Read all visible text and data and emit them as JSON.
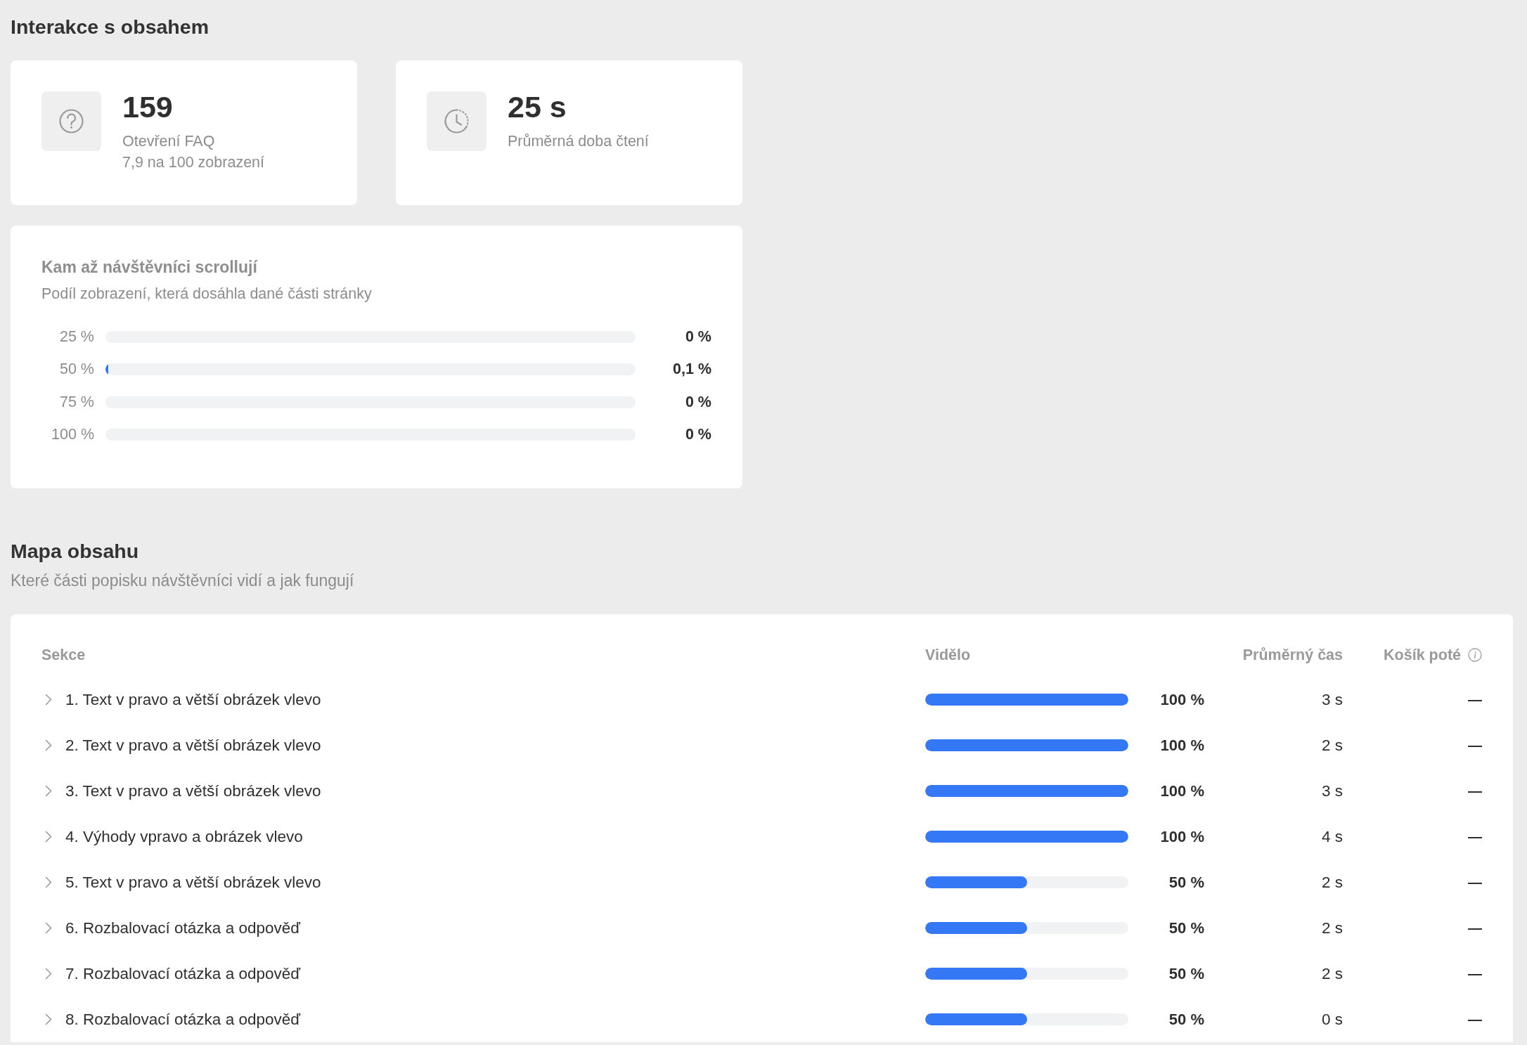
{
  "interactions": {
    "title": "Interakce s obsahem",
    "stats": [
      {
        "kind": "faq",
        "value": "159",
        "label": "Otevření FAQ",
        "note": "7,9 na 100 zobrazení"
      },
      {
        "kind": "time",
        "value": "25 s",
        "label": "Průměrná doba čtení"
      }
    ],
    "scroll_depth": {
      "title": "Kam až návštěvníci scrollují",
      "subtitle": "Podíl zobrazení, která dosáhla dané části stránky",
      "rows": [
        {
          "label": "25 %",
          "level": 0,
          "reading": "0 %"
        },
        {
          "label": "50 %",
          "level": 0.001,
          "reading": "0,1 %"
        },
        {
          "label": "75 %",
          "level": 0,
          "reading": "0 %"
        },
        {
          "label": "100 %",
          "level": 0,
          "reading": "0 %"
        }
      ]
    }
  },
  "content_map": {
    "title": "Mapa obsahu",
    "subtitle": "Které části popisku návštěvníci vidí a jak fungují",
    "table": {
      "columns": [
        {
          "label": "Sekce",
          "info": false
        },
        {
          "label": "Vidělo",
          "info": false
        },
        {
          "label": "Průměrný čas",
          "info": false
        },
        {
          "label": "Košík poté",
          "info": true
        }
      ],
      "rows": [
        {
          "section": "1. Text v pravo a větší obrázek vlevo",
          "expanded": false,
          "level": 1,
          "seen": "100 %",
          "avg_time": "3 s",
          "cart_after": "—"
        },
        {
          "section": "2. Text v pravo a větší obrázek vlevo",
          "expanded": false,
          "level": 1,
          "seen": "100 %",
          "avg_time": "2 s",
          "cart_after": "—"
        },
        {
          "section": "3. Text v pravo a větší obrázek vlevo",
          "expanded": false,
          "level": 1,
          "seen": "100 %",
          "avg_time": "3 s",
          "cart_after": "—"
        },
        {
          "section": "4. Výhody vpravo a obrázek vlevo",
          "expanded": false,
          "level": 1,
          "seen": "100 %",
          "avg_time": "4 s",
          "cart_after": "—"
        },
        {
          "section": "5. Text v pravo a větší obrázek vlevo",
          "expanded": false,
          "level": 0.5,
          "seen": "50 %",
          "avg_time": "2 s",
          "cart_after": "—"
        },
        {
          "section": "6. Rozbalovací otázka a odpověď",
          "expanded": false,
          "level": 0.5,
          "seen": "50 %",
          "avg_time": "2 s",
          "cart_after": "—"
        },
        {
          "section": "7. Rozbalovací otázka a odpověď",
          "expanded": false,
          "level": 0.5,
          "seen": "50 %",
          "avg_time": "2 s",
          "cart_after": "—"
        },
        {
          "section": "8. Rozbalovací otázka a odpověď",
          "expanded": false,
          "level": 0.5,
          "seen": "50 %",
          "avg_time": "0 s",
          "cart_after": "—"
        }
      ]
    }
  }
}
